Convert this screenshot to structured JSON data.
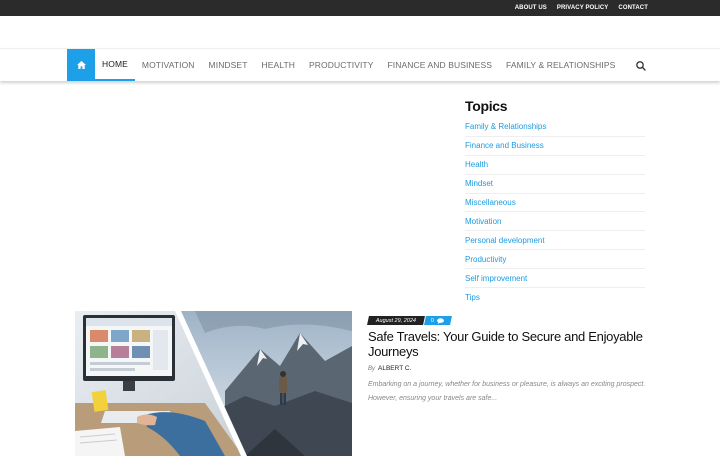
{
  "topbar": {
    "links": [
      "ABOUT US",
      "PRIVACY POLICY",
      "CONTACT"
    ]
  },
  "nav": {
    "home_icon": "home-icon",
    "items": [
      "HOME",
      "MOTIVATION",
      "MINDSET",
      "HEALTH",
      "PRODUCTIVITY",
      "FINANCE AND BUSINESS",
      "FAMILY & RELATIONSHIPS"
    ],
    "active": "HOME",
    "search_icon": "search-icon"
  },
  "sidebar": {
    "title": "Topics",
    "topics": [
      "Family & Relationships",
      "Finance and Business",
      "Health",
      "Mindset",
      "Miscellaneous",
      "Motivation",
      "Personal development",
      "Productivity",
      "Self improvement",
      "Tips"
    ]
  },
  "article": {
    "date": "August 29, 2024",
    "comments": "0",
    "comment_icon": "comments-icon",
    "title": "Safe Travels: Your Guide to Secure and Enjoyable Journeys",
    "by": "By",
    "author": "ALBERT C.",
    "excerpt": "Embarking on a journey, whether for business or pleasure, is always an exciting prospect. However, ensuring your travels are safe..."
  },
  "colors": {
    "accent": "#1ea0e8",
    "topbar": "#2b2b2b"
  }
}
